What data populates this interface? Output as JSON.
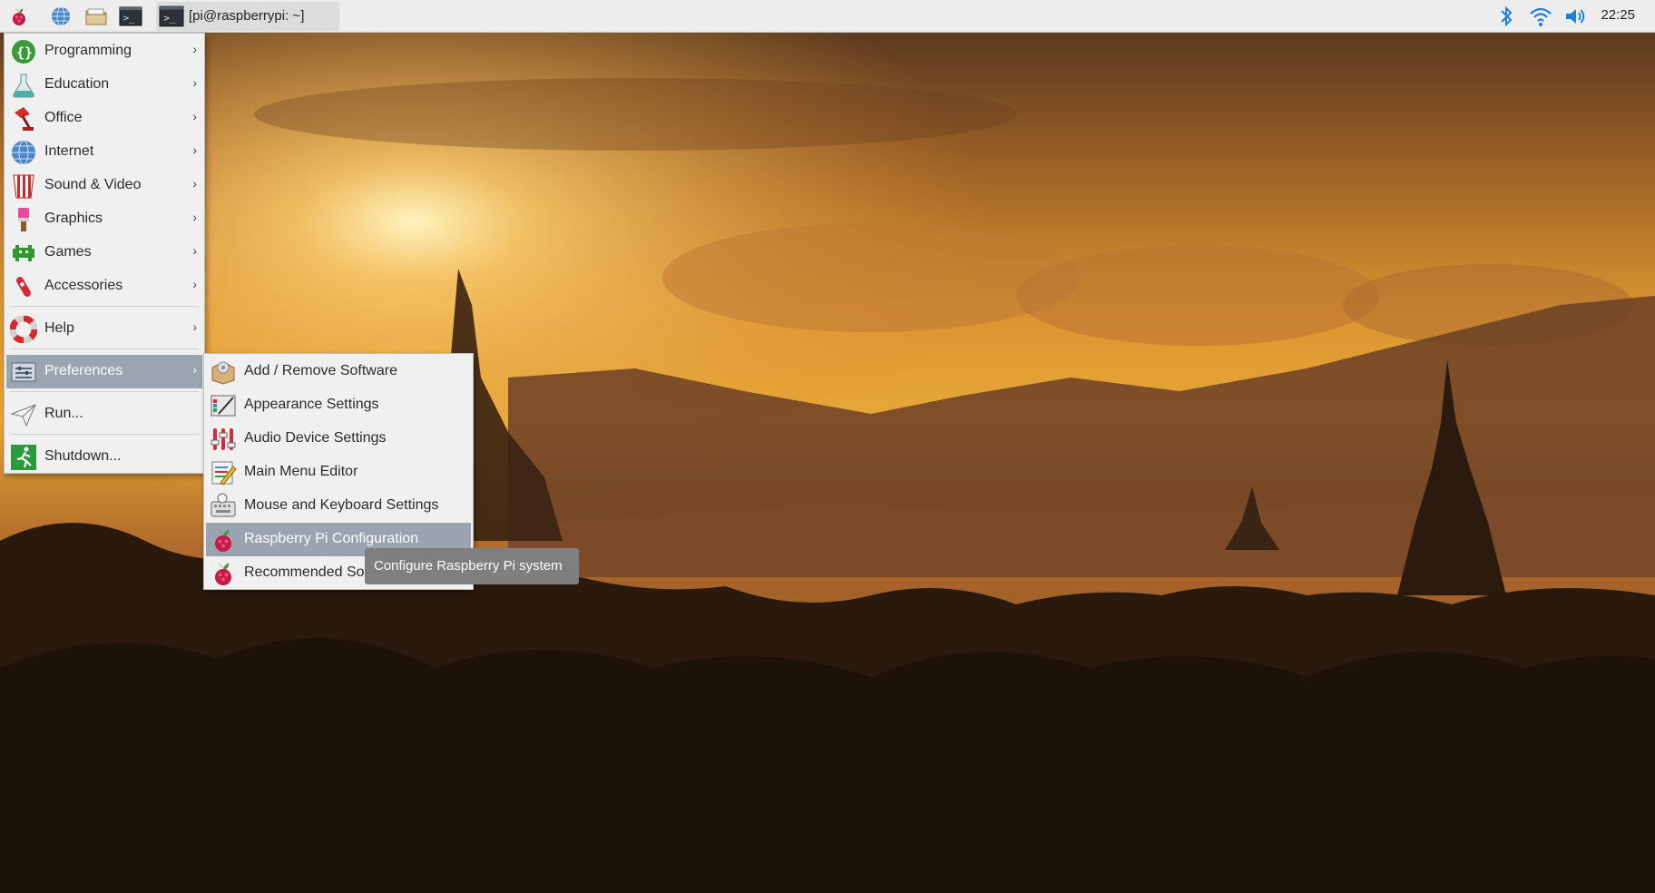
{
  "taskbar": {
    "launchers": [
      {
        "icon": "raspberry-menu-icon"
      },
      {
        "icon": "web-browser-icon"
      },
      {
        "icon": "file-manager-icon"
      },
      {
        "icon": "terminal-icon"
      }
    ],
    "window_title": "[pi@raspberrypi: ~]",
    "clock": "22:25",
    "tray": [
      "bluetooth-icon",
      "wifi-icon",
      "volume-icon"
    ]
  },
  "main_menu": {
    "items": [
      {
        "label": "Programming",
        "icon": "programming-icon",
        "submenu": true
      },
      {
        "label": "Education",
        "icon": "education-icon",
        "submenu": true
      },
      {
        "label": "Office",
        "icon": "office-icon",
        "submenu": true
      },
      {
        "label": "Internet",
        "icon": "internet-icon",
        "submenu": true
      },
      {
        "label": "Sound & Video",
        "icon": "sound-video-icon",
        "submenu": true
      },
      {
        "label": "Graphics",
        "icon": "graphics-icon",
        "submenu": true
      },
      {
        "label": "Games",
        "icon": "games-icon",
        "submenu": true
      },
      {
        "label": "Accessories",
        "icon": "accessories-icon",
        "submenu": true
      },
      {
        "label": "Help",
        "icon": "help-icon",
        "submenu": true
      },
      {
        "label": "Preferences",
        "icon": "preferences-icon",
        "submenu": true,
        "active": true
      },
      {
        "label": "Run...",
        "icon": "run-icon",
        "submenu": false
      },
      {
        "label": "Shutdown...",
        "icon": "shutdown-icon",
        "submenu": false
      }
    ],
    "arrow": "›"
  },
  "preferences_menu": {
    "items": [
      {
        "label": "Add / Remove Software",
        "icon": "package-icon"
      },
      {
        "label": "Appearance Settings",
        "icon": "appearance-icon"
      },
      {
        "label": "Audio Device Settings",
        "icon": "audio-settings-icon"
      },
      {
        "label": "Main Menu Editor",
        "icon": "menu-editor-icon"
      },
      {
        "label": "Mouse and Keyboard Settings",
        "icon": "keyboard-mouse-icon"
      },
      {
        "label": "Raspberry Pi Configuration",
        "icon": "raspberry-icon",
        "hovered": true
      },
      {
        "label": "Recommended Sof",
        "icon": "raspberry-icon"
      }
    ]
  },
  "tooltip": "Configure Raspberry Pi system",
  "colors": {
    "taskbar_bg": "#ededed",
    "menu_bg": "#f0f0f0",
    "active_item": "#9aa5b0",
    "tooltip_bg": "#7f7f7f",
    "accent_blue": "#1f7fdc"
  }
}
